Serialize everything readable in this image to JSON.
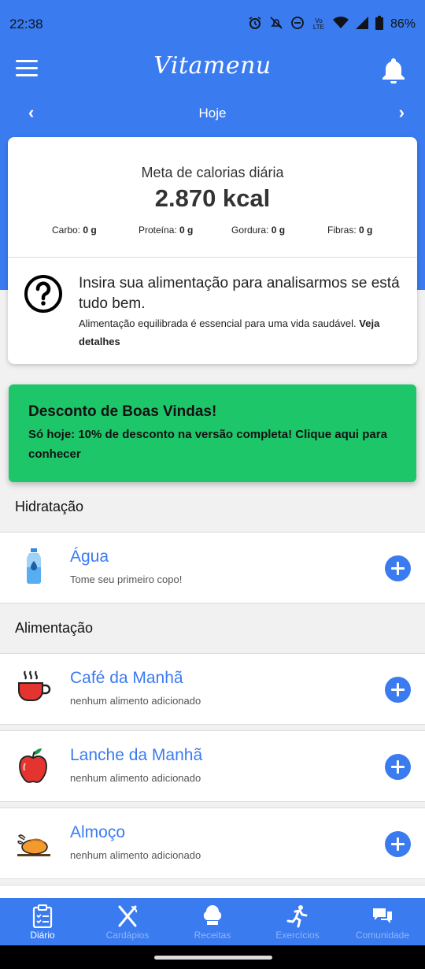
{
  "status_bar": {
    "time": "22:38",
    "battery": "86%",
    "network": "Vo LTE",
    "icons": [
      "alarm-icon",
      "mute-icon",
      "dnd-icon",
      "lte-icon",
      "wifi-icon",
      "signal-icon",
      "battery-icon"
    ]
  },
  "app_bar": {
    "logo": "Vitamenu",
    "menu_icon": "hamburger-menu-icon",
    "notification_icon": "bell-icon"
  },
  "date_nav": {
    "label": "Hoje",
    "prev": "‹",
    "next": "›"
  },
  "summary": {
    "title": "Meta de calorias diária",
    "kcal": "2.870 kcal",
    "macros": [
      {
        "label": "Carbo:",
        "value": "0 g"
      },
      {
        "label": "Proteína:",
        "value": "0 g"
      },
      {
        "label": "Gordura:",
        "value": "0 g"
      },
      {
        "label": "Fibras:",
        "value": "0 g"
      }
    ],
    "tip_title": "Insira sua alimentação para analisarmos se está tudo bem.",
    "tip_sub": "Alimentação equilibrada é essencial para uma vida saudável.",
    "tip_link": "Veja detalhes"
  },
  "promo": {
    "title": "Desconto de Boas Vindas!",
    "text": "Só hoje: 10% de desconto na versão completa! Clique aqui para conhecer"
  },
  "sections": {
    "hydration": "Hidratação",
    "food": "Alimentação"
  },
  "water": {
    "name": "Água",
    "sub": "Tome seu primeiro copo!",
    "icon": "water-bottle-icon"
  },
  "meals": [
    {
      "name": "Café da Manhã",
      "sub": "nenhum alimento adicionado",
      "icon": "coffee-cup-icon"
    },
    {
      "name": "Lanche da Manhã",
      "sub": "nenhum alimento adicionado",
      "icon": "apple-icon"
    },
    {
      "name": "Almoço",
      "sub": "nenhum alimento adicionado",
      "icon": "roast-chicken-icon"
    }
  ],
  "bottom_nav": [
    {
      "label": "Diário",
      "icon": "diary-clipboard-icon",
      "active": true
    },
    {
      "label": "Cardápios",
      "icon": "fork-knife-icon",
      "active": false
    },
    {
      "label": "Receitas",
      "icon": "chef-hat-icon",
      "active": false
    },
    {
      "label": "Exercícios",
      "icon": "running-person-icon",
      "active": false
    },
    {
      "label": "Comunidade",
      "icon": "chat-bubbles-icon",
      "active": false
    }
  ],
  "colors": {
    "primary": "#3a7bf0",
    "promo": "#1ec66a",
    "background": "#f1f1f1"
  }
}
